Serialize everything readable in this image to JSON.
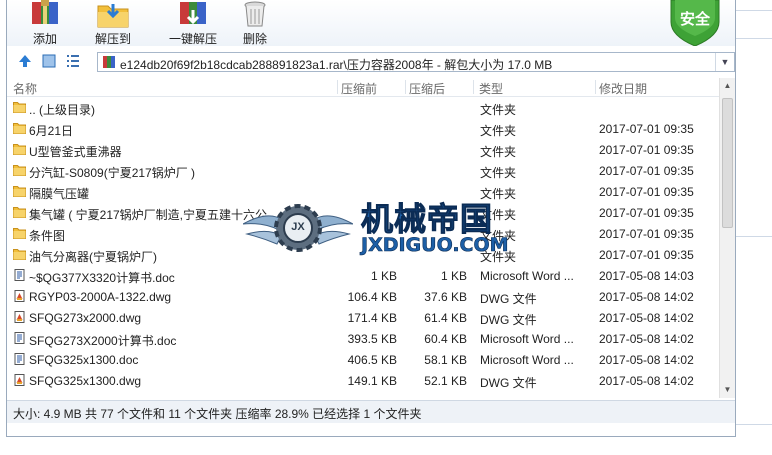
{
  "toolbar": {
    "add_label": "添加",
    "extract_label": "解压到",
    "oneclick_label": "一键解压",
    "delete_label": "删除",
    "safe_label": "安全"
  },
  "address": {
    "path": "e124db20f69f2b18cdcab288891823a1.rar\\压力容器2008年 - 解包大小为 17.0 MB"
  },
  "columns": {
    "name": "名称",
    "compressed": "压缩前",
    "packed": "压缩后",
    "type": "类型",
    "modified": "修改日期"
  },
  "files": [
    {
      "name": ".. (上级目录)",
      "size": "",
      "packed": "",
      "type": "文件夹",
      "date": "",
      "icon": "folder-icon"
    },
    {
      "name": "6月21日",
      "size": "",
      "packed": "",
      "type": "文件夹",
      "date": "2017-07-01 09:35",
      "icon": "folder-icon"
    },
    {
      "name": "U型管釜式重沸器",
      "size": "",
      "packed": "",
      "type": "文件夹",
      "date": "2017-07-01 09:35",
      "icon": "folder-icon"
    },
    {
      "name": "分汽缸-S0809(宁夏217锅炉厂 )",
      "size": "",
      "packed": "",
      "type": "文件夹",
      "date": "2017-07-01 09:35",
      "icon": "folder-icon"
    },
    {
      "name": "隔膜气压罐",
      "size": "",
      "packed": "",
      "type": "文件夹",
      "date": "2017-07-01 09:35",
      "icon": "folder-icon"
    },
    {
      "name": "集气罐 ( 宁夏217锅炉厂制造,宁夏五建十六公",
      "size": "",
      "packed": "",
      "type": "文件夹",
      "date": "2017-07-01 09:35",
      "icon": "folder-icon"
    },
    {
      "name": "条件图",
      "size": "",
      "packed": "",
      "type": "文件夹",
      "date": "2017-07-01 09:35",
      "icon": "folder-icon"
    },
    {
      "name": "油气分离器(宁夏锅炉厂)",
      "size": "",
      "packed": "",
      "type": "文件夹",
      "date": "2017-07-01 09:35",
      "icon": "folder-icon"
    },
    {
      "name": "~$QG377X3320计算书.doc",
      "size": "1 KB",
      "packed": "1 KB",
      "type": "Microsoft Word ...",
      "date": "2017-05-08 14:03",
      "icon": "word-doc-icon"
    },
    {
      "name": "RGYP03-2000A-1322.dwg",
      "size": "106.4 KB",
      "packed": "37.6 KB",
      "type": "DWG 文件",
      "date": "2017-05-08 14:02",
      "icon": "dwg-file-icon"
    },
    {
      "name": "SFQG273x2000.dwg",
      "size": "171.4 KB",
      "packed": "61.4 KB",
      "type": "DWG 文件",
      "date": "2017-05-08 14:02",
      "icon": "dwg-file-icon"
    },
    {
      "name": "SFQG273X2000计算书.doc",
      "size": "393.5 KB",
      "packed": "60.4 KB",
      "type": "Microsoft Word ...",
      "date": "2017-05-08 14:02",
      "icon": "word-doc-icon"
    },
    {
      "name": "SFQG325x1300.doc",
      "size": "406.5 KB",
      "packed": "58.1 KB",
      "type": "Microsoft Word ...",
      "date": "2017-05-08 14:02",
      "icon": "word-doc-icon"
    },
    {
      "name": "SFQG325x1300.dwg",
      "size": "149.1 KB",
      "packed": "52.1 KB",
      "type": "DWG 文件",
      "date": "2017-05-08 14:02",
      "icon": "dwg-file-icon"
    }
  ],
  "status": {
    "text": "大小: 4.9 MB 共 77 个文件和 11 个文件夹 压缩率 28.9% 已经选择 1 个文件夹"
  },
  "watermark": {
    "brand": "机械帝国",
    "domain": "JXDIGUO.COM",
    "emblem": "JX"
  },
  "colors": {
    "folder": "#f2bf3b",
    "safe_shield": "#3ea236",
    "watermark_blue": "#1d5fa6",
    "accent": "#2f6fb5"
  }
}
